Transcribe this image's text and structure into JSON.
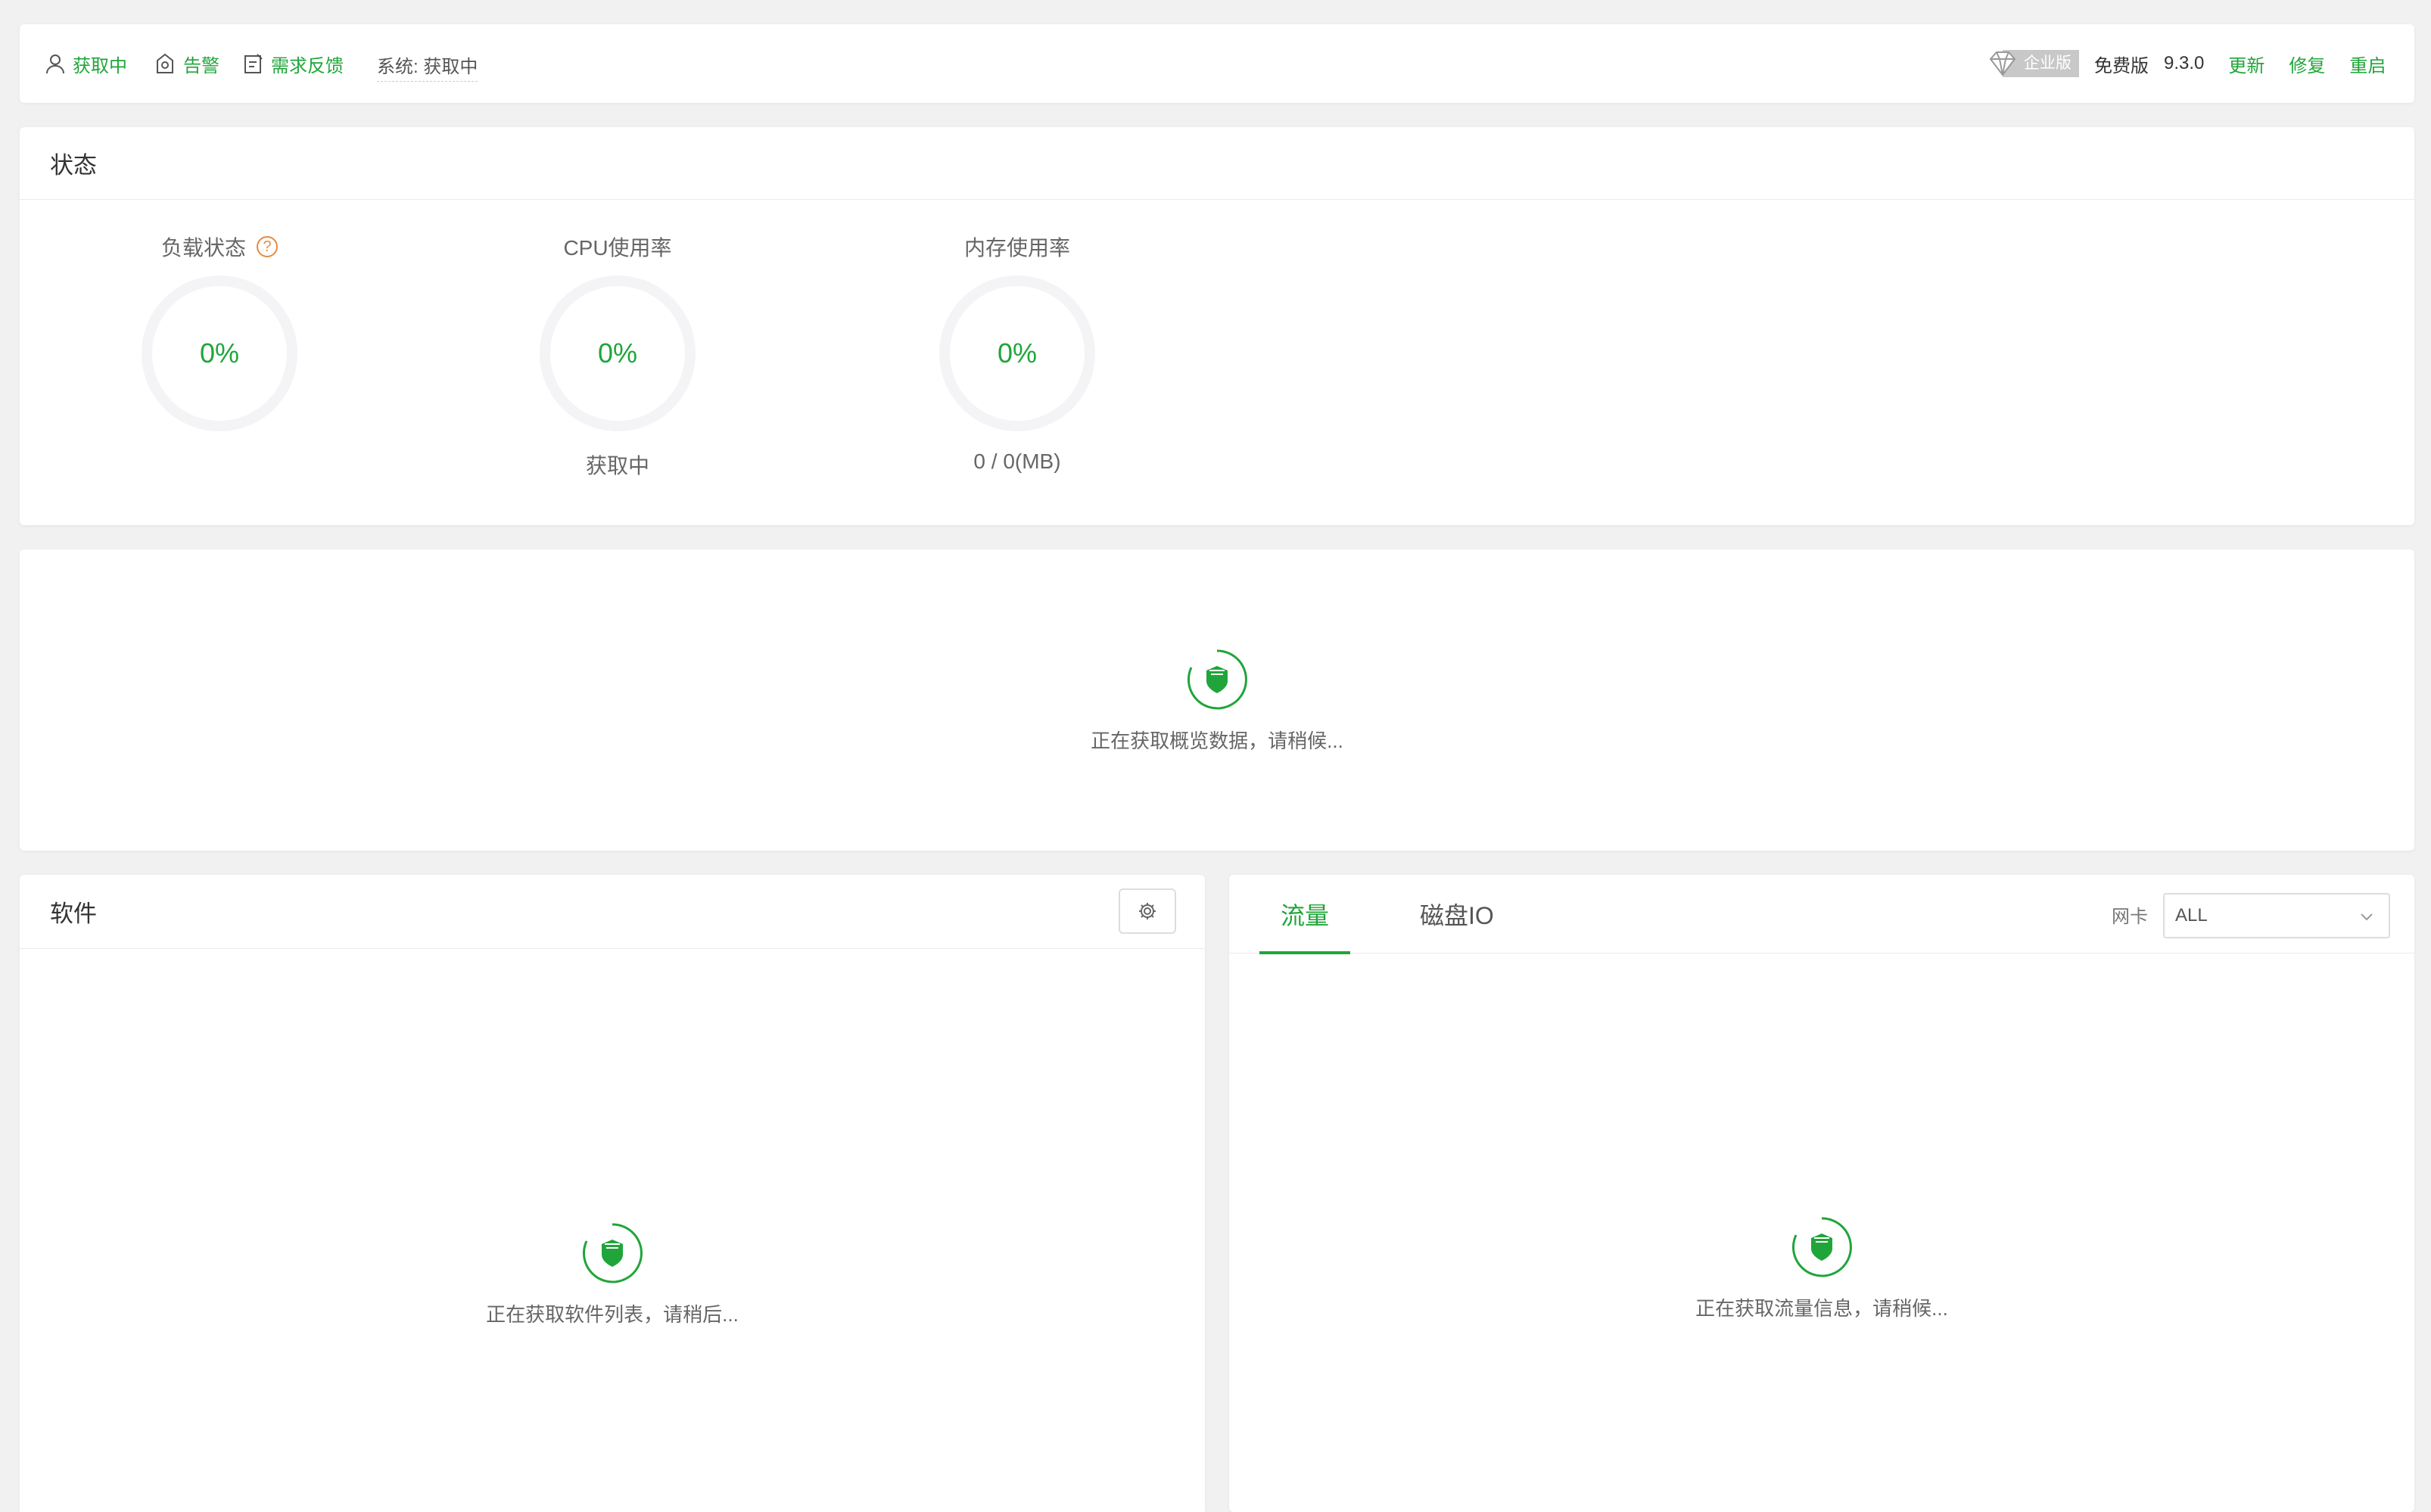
{
  "topbar": {
    "user_label": "获取中",
    "alarm_label": "告警",
    "feedback_label": "需求反馈",
    "system_label": "系统: 获取中",
    "enterprise_label": "企业版",
    "edition_label": "免费版",
    "version": "9.3.0",
    "update_label": "更新",
    "repair_label": "修复",
    "restart_label": "重启"
  },
  "status": {
    "title": "状态",
    "help_mark": "?",
    "gauges": [
      {
        "title": "负载状态",
        "value": "0%",
        "sub": ""
      },
      {
        "title": "CPU使用率",
        "value": "0%",
        "sub": "获取中"
      },
      {
        "title": "内存使用率",
        "value": "0%",
        "sub": "0 / 0(MB)"
      }
    ]
  },
  "overview": {
    "loading_text": "正在获取概览数据，请稍候..."
  },
  "software": {
    "title": "软件",
    "loading_text": "正在获取软件列表，请稍后..."
  },
  "traffic": {
    "tabs": [
      {
        "label": "流量",
        "active": true
      },
      {
        "label": "磁盘IO",
        "active": false
      }
    ],
    "nic_label": "网卡",
    "nic_value": "ALL",
    "loading_text": "正在获取流量信息，请稍候..."
  },
  "colors": {
    "accent": "#20a53a",
    "help": "#e78a3f",
    "badge": "#c8c8c8"
  },
  "icons": [
    "user-icon",
    "alarm-icon",
    "feedback-icon",
    "diamond-icon",
    "help-icon",
    "gear-icon",
    "loading-shield-icon",
    "chevron-down-icon"
  ]
}
